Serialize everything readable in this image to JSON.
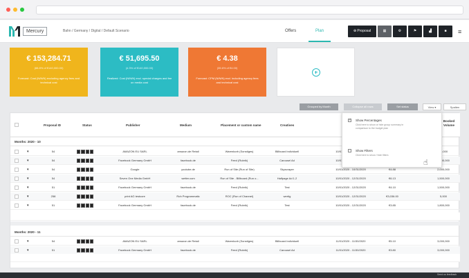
{
  "app": {
    "brand": "Mercury",
    "breadcrumb": "Bahn / Germany / Digital / Default Scenario",
    "nav": {
      "offers": "Offers",
      "plan": "Plan"
    },
    "toolbar": {
      "proposal": "Proposal"
    }
  },
  "kpis": [
    {
      "value": "€ 153,284.71",
      "sub": "(88.8% of €140,000.00)",
      "desc": "Forecast: Cost (N/N/N) excluding agency fees and technical cost"
    },
    {
      "value": "€ 51,695.50",
      "sub": "(4.3% of €140,000.00)",
      "desc": "Realized: Cost (N/N/N) excl. special charges and fee on media cost"
    },
    {
      "value": "€ 4.38",
      "sub": "(35.6% of €4.00)",
      "desc": "Forecast: CPM (N/N/N) excl. including agency fees and technical cost"
    }
  ],
  "table_toolbar": {
    "group_by": "Grouped by Month",
    "collapse": "Collapse all rows",
    "set_status": "Set status",
    "view": "View",
    "settings": "Spalten"
  },
  "columns": [
    "Proposal ID",
    "Status",
    "Publisher",
    "Medium",
    "Placement or custom name",
    "Creatives",
    "",
    "",
    "Booked Volume"
  ],
  "groups": [
    {
      "label": "Months: 2020 - 10",
      "rows": [
        {
          "id": "54",
          "publisher": "AMAZON EU SARL",
          "medium": "amazon.de Retail",
          "placement": "Warenkorb (Sonstiges)",
          "creative": "Billboard individuell",
          "date": "10/01/2020 - 10/31/2020",
          "price": "",
          "volume": "30,000"
        },
        {
          "id": "54",
          "publisher": "Facebook Germany GmbH",
          "medium": "facebook.de",
          "placement": "Feed (Rubrik)",
          "creative": "Carousel Ad",
          "date": "10/01/2020 - 10/31/2020",
          "price": "",
          "volume": "1,500,000"
        },
        {
          "id": "54",
          "publisher": "Google",
          "medium": "youtube.de",
          "placement": "Run of Site (Run of Site)",
          "creative": "Skyscraper",
          "date": "10/01/2020 - 10/31/2020",
          "price": "€4.88",
          "volume": "2,000,000"
        },
        {
          "id": "54",
          "publisher": "Seven One Media GmbH",
          "medium": "wetter.com",
          "placement": "Run of Site - Billboard (Run o...",
          "creative": "Halfpage Ad 1.2",
          "date": "10/01/2020 - 12/31/2020",
          "price": "€6.13",
          "volume": "1,500,000"
        },
        {
          "id": "51",
          "publisher": "Facebook Germany GmbH",
          "medium": "facebook.de",
          "placement": "Feed (Rubrik)",
          "creative": "Test",
          "date": "10/01/2020 - 12/31/2020",
          "price": "€4.10",
          "volume": "1,500,000"
        },
        {
          "id": "258",
          "publisher": "print AG testcore",
          "medium": "Roh Programmatic",
          "placement": "ROC (Run of Channel)",
          "creative": "wertig",
          "date": "10/01/2020 - 12/31/2020",
          "price": "€3,036.00",
          "volume": "5,000"
        },
        {
          "id": "51",
          "publisher": "Facebook Germany GmbH",
          "medium": "facebook.de",
          "placement": "Feed (Rubrik)",
          "creative": "Test",
          "date": "10/01/2020 - 12/31/2020",
          "price": "€3.85",
          "volume": "1,800,000"
        }
      ]
    },
    {
      "label": "Months: 2020 - 11",
      "rows": [
        {
          "id": "54",
          "publisher": "AMAZON EU SARL",
          "medium": "amazon.de Retail",
          "placement": "Warenkorb (Sonstiges)",
          "creative": "Billboard individuell",
          "date": "11/01/2020 - 11/30/2020",
          "price": "€5.10",
          "volume": "3,000,000"
        },
        {
          "id": "51",
          "publisher": "Facebook Germany GmbH",
          "medium": "facebook.de",
          "placement": "Feed (Rubrik)",
          "creative": "Carousel Ad",
          "date": "11/01/2020 - 11/30/2020",
          "price": "€3.80",
          "volume": "3,000,000"
        }
      ]
    }
  ],
  "view_menu": {
    "show_percentages": {
      "title": "Show Percentages",
      "desc": "Click here to show or hide group summary in comparison to the budget plan"
    },
    "show_filters": {
      "title": "Show Filters",
      "desc": "Click here to show / hide filters"
    }
  },
  "footer": {
    "feedback": "Send us feedback"
  }
}
